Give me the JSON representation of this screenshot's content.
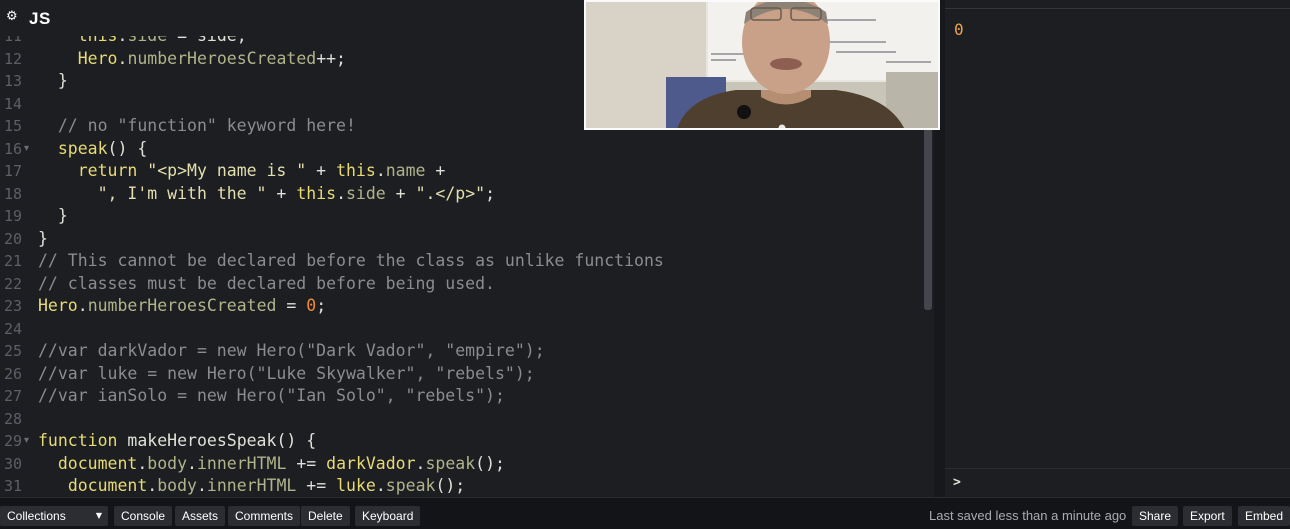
{
  "editor": {
    "language_label": "JS",
    "settings_icon": "gear-icon",
    "lines": [
      {
        "num": "11",
        "fold": false,
        "tokens": [
          [
            "plain",
            "    "
          ],
          [
            "kw",
            "this"
          ],
          [
            "plain",
            "."
          ],
          [
            "prop",
            "side"
          ],
          [
            "plain",
            " = side;"
          ]
        ]
      },
      {
        "num": "12",
        "fold": false,
        "tokens": [
          [
            "plain",
            "    "
          ],
          [
            "kw",
            "Hero"
          ],
          [
            "plain",
            "."
          ],
          [
            "prop",
            "numberHeroesCreated"
          ],
          [
            "plain",
            "++;"
          ]
        ]
      },
      {
        "num": "13",
        "fold": false,
        "tokens": [
          [
            "plain",
            "  }"
          ]
        ]
      },
      {
        "num": "14",
        "fold": false,
        "tokens": []
      },
      {
        "num": "15",
        "fold": false,
        "tokens": [
          [
            "plain",
            "  "
          ],
          [
            "com",
            "// no \"function\" keyword here!"
          ]
        ]
      },
      {
        "num": "16",
        "fold": true,
        "tokens": [
          [
            "plain",
            "  "
          ],
          [
            "kw",
            "speak"
          ],
          [
            "plain",
            "() {"
          ]
        ]
      },
      {
        "num": "17",
        "fold": false,
        "tokens": [
          [
            "plain",
            "    "
          ],
          [
            "kw",
            "return"
          ],
          [
            "plain",
            " "
          ],
          [
            "str",
            "\"<p>My name is \""
          ],
          [
            "plain",
            " + "
          ],
          [
            "kw",
            "this"
          ],
          [
            "plain",
            "."
          ],
          [
            "prop",
            "name"
          ],
          [
            "plain",
            " +"
          ]
        ]
      },
      {
        "num": "18",
        "fold": false,
        "tokens": [
          [
            "plain",
            "      "
          ],
          [
            "str",
            "\", I'm with the \""
          ],
          [
            "plain",
            " + "
          ],
          [
            "kw",
            "this"
          ],
          [
            "plain",
            "."
          ],
          [
            "prop",
            "side"
          ],
          [
            "plain",
            " + "
          ],
          [
            "str",
            "\".</p>\""
          ],
          [
            "plain",
            ";"
          ]
        ]
      },
      {
        "num": "19",
        "fold": false,
        "tokens": [
          [
            "plain",
            "  }"
          ]
        ]
      },
      {
        "num": "20",
        "fold": false,
        "tokens": [
          [
            "plain",
            "}"
          ]
        ]
      },
      {
        "num": "21",
        "fold": false,
        "tokens": [
          [
            "com",
            "// This cannot be declared before the class as unlike functions"
          ]
        ]
      },
      {
        "num": "22",
        "fold": false,
        "tokens": [
          [
            "com",
            "// classes must be declared before being used."
          ]
        ]
      },
      {
        "num": "23",
        "fold": false,
        "tokens": [
          [
            "kw",
            "Hero"
          ],
          [
            "plain",
            "."
          ],
          [
            "prop",
            "numberHeroesCreated"
          ],
          [
            "plain",
            " = "
          ],
          [
            "num",
            "0"
          ],
          [
            "plain",
            ";"
          ]
        ]
      },
      {
        "num": "24",
        "fold": false,
        "tokens": []
      },
      {
        "num": "25",
        "fold": false,
        "tokens": [
          [
            "com",
            "//var darkVador = new Hero(\"Dark Vador\", \"empire\");"
          ]
        ]
      },
      {
        "num": "26",
        "fold": false,
        "tokens": [
          [
            "com",
            "//var luke = new Hero(\"Luke Skywalker\", \"rebels\");"
          ]
        ]
      },
      {
        "num": "27",
        "fold": false,
        "tokens": [
          [
            "com",
            "//var ianSolo = new Hero(\"Ian Solo\", \"rebels\");"
          ]
        ]
      },
      {
        "num": "28",
        "fold": false,
        "tokens": []
      },
      {
        "num": "29",
        "fold": true,
        "tokens": [
          [
            "kw",
            "function"
          ],
          [
            "plain",
            " "
          ],
          [
            "fn",
            "makeHeroesSpeak"
          ],
          [
            "plain",
            "() {"
          ]
        ]
      },
      {
        "num": "30",
        "fold": false,
        "tokens": [
          [
            "plain",
            "  "
          ],
          [
            "kw",
            "document"
          ],
          [
            "plain",
            "."
          ],
          [
            "prop",
            "body"
          ],
          [
            "plain",
            "."
          ],
          [
            "prop",
            "innerHTML"
          ],
          [
            "plain",
            " += "
          ],
          [
            "kw",
            "darkVador"
          ],
          [
            "plain",
            "."
          ],
          [
            "prop",
            "speak"
          ],
          [
            "plain",
            "();"
          ]
        ]
      },
      {
        "num": "31",
        "fold": false,
        "tokens": [
          [
            "plain",
            "   "
          ],
          [
            "kw",
            "document"
          ],
          [
            "plain",
            "."
          ],
          [
            "prop",
            "body"
          ],
          [
            "plain",
            "."
          ],
          [
            "prop",
            "innerHTML"
          ],
          [
            "plain",
            " += "
          ],
          [
            "kw",
            "luke"
          ],
          [
            "plain",
            "."
          ],
          [
            "prop",
            "speak"
          ],
          [
            "plain",
            "();"
          ]
        ]
      }
    ]
  },
  "preview": {
    "output": "0"
  },
  "console": {
    "prompt": ">"
  },
  "footer": {
    "collections_label": "Collections",
    "buttons": [
      "Console",
      "Assets",
      "Comments",
      "Delete",
      "Keyboard"
    ],
    "status": "Last saved less than a minute ago",
    "right_buttons": [
      "Share",
      "Export",
      "Embed"
    ]
  },
  "colors": {
    "background": "#1d1e22",
    "footer": "#131417",
    "keyword": "#e6db74",
    "comment": "#8a8c8f",
    "number": "#f28b32",
    "preview_output": "#f0a14e"
  }
}
